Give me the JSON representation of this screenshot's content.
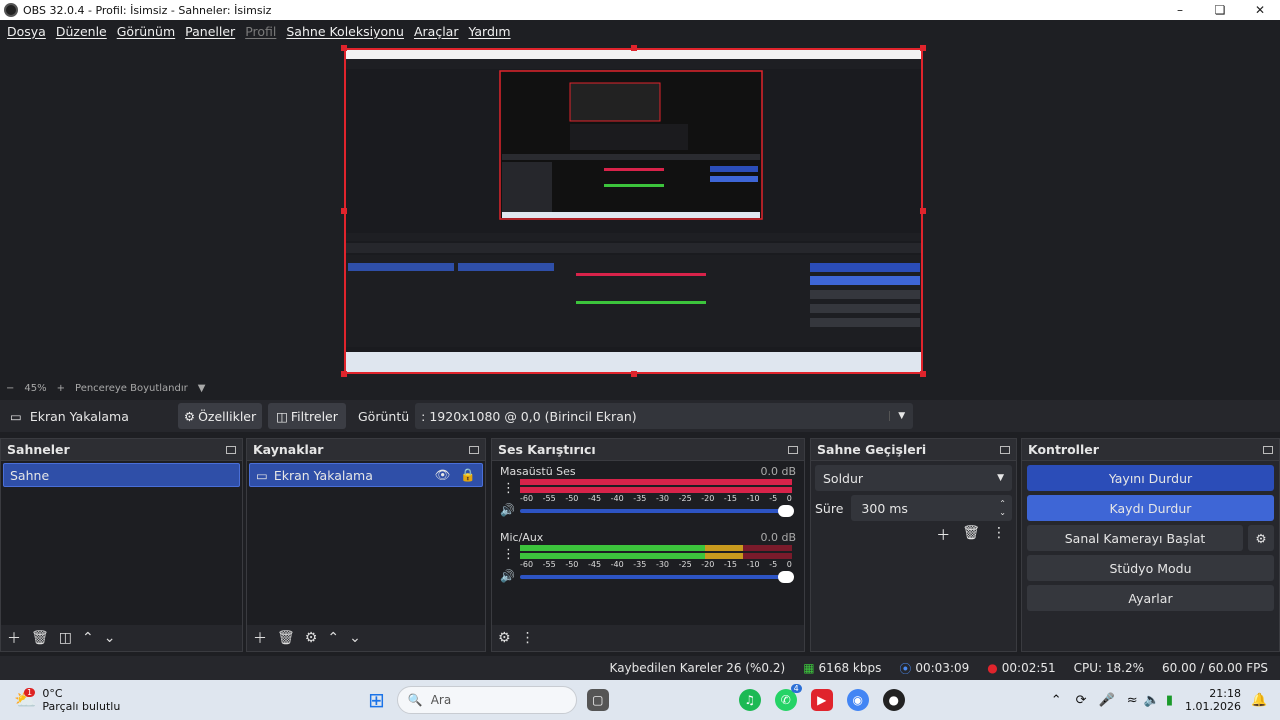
{
  "window": {
    "title": "OBS 32.0.4 - Profil: İsimsiz - Sahneler: İsimsiz"
  },
  "menu": [
    {
      "label": "Dosya",
      "disabled": false
    },
    {
      "label": "Düzenle",
      "disabled": false
    },
    {
      "label": "Görünüm",
      "disabled": false
    },
    {
      "label": "Paneller",
      "disabled": false
    },
    {
      "label": "Profil",
      "disabled": true
    },
    {
      "label": "Sahne Koleksiyonu",
      "disabled": false
    },
    {
      "label": "Araçlar",
      "disabled": false
    },
    {
      "label": "Yardım",
      "disabled": false
    }
  ],
  "zoom": {
    "minus": "−",
    "value": "45%",
    "plus": "+",
    "fit_label": "Pencereye Boyutlandır"
  },
  "source_bar": {
    "source_name": "Ekran Yakalama",
    "properties": "Özellikler",
    "filters": "Filtreler",
    "display_label": "Görüntü",
    "display_value": ": 1920x1080 @ 0,0 (Birincil Ekran)"
  },
  "scenes": {
    "title": "Sahneler",
    "items": [
      "Sahne"
    ]
  },
  "sources": {
    "title": "Kaynaklar",
    "items": [
      "Ekran Yakalama"
    ]
  },
  "mixer": {
    "title": "Ses Karıştırıcı",
    "channels": [
      {
        "name": "Masaüstü Ses",
        "db": "0.0 dB",
        "color": "#d8234a"
      },
      {
        "name": "Mic/Aux",
        "db": "0.0 dB",
        "color": "#3cc43c"
      }
    ],
    "ticks": [
      "-60",
      "-55",
      "-50",
      "-45",
      "-40",
      "-35",
      "-30",
      "-25",
      "-20",
      "-15",
      "-10",
      "-5",
      "0"
    ]
  },
  "transitions": {
    "title": "Sahne Geçişleri",
    "type": "Soldur",
    "duration_label": "Süre",
    "duration_value": "300 ms"
  },
  "controls": {
    "title": "Kontroller",
    "stop_stream": "Yayını Durdur",
    "stop_record": "Kaydı Durdur",
    "virtual_cam": "Sanal Kamerayı Başlat",
    "studio_mode": "Stüdyo Modu",
    "settings": "Ayarlar"
  },
  "status": {
    "dropped": "Kaybedilen Kareler 26 (%0.2)",
    "bitrate": "6168 kbps",
    "stream_time": "00:03:09",
    "rec_time": "00:02:51",
    "cpu": "CPU: 18.2%",
    "fps": "60.00 / 60.00 FPS"
  },
  "taskbar": {
    "weather_temp": "0°C",
    "weather_desc": "Parçalı bulutlu",
    "weather_badge": "1",
    "search_placeholder": "Ara",
    "time": "21:18",
    "date": "1.01.2026",
    "whatsapp_badge": "4"
  },
  "colors": {
    "accent": "#2b4db8",
    "record_red": "#e0242c",
    "bg": "#1e1f23"
  }
}
